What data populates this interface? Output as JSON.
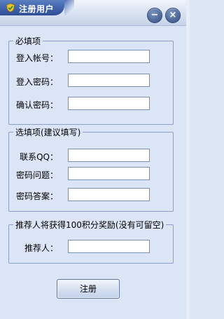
{
  "window": {
    "title": "注册用户",
    "accent_color": "#3c5fa8",
    "minimize_label": "−",
    "close_label": "×"
  },
  "required_section": {
    "legend": "必填项",
    "fields": [
      {
        "label": "登入帐号：",
        "value": ""
      },
      {
        "label": "登入密码：",
        "value": ""
      },
      {
        "label": "确认密码：",
        "value": ""
      }
    ]
  },
  "optional_section": {
    "legend": "选填项(建议填写)",
    "fields": [
      {
        "label": "联系QQ：",
        "value": ""
      },
      {
        "label": "密码问题：",
        "value": ""
      },
      {
        "label": "密码答案：",
        "value": ""
      }
    ]
  },
  "referrer_section": {
    "legend": "推荐人将获得100积分奖励(没有可留空)",
    "fields": [
      {
        "label": "推荐人：",
        "value": ""
      }
    ]
  },
  "submit_label": "注册"
}
